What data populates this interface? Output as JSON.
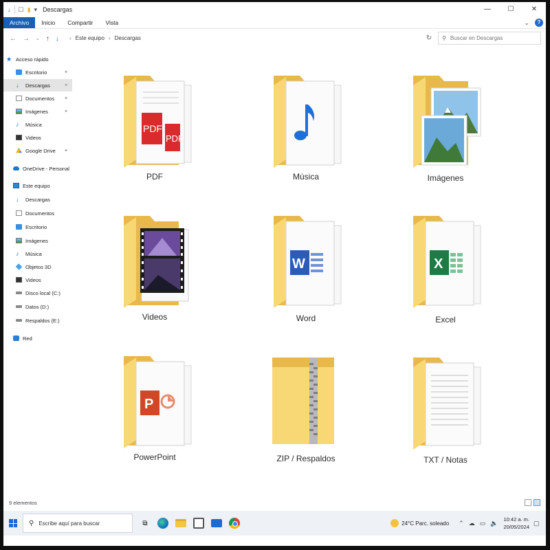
{
  "window": {
    "title": "Descargas"
  },
  "ribbon": {
    "tabs": [
      "Archivo",
      "Inicio",
      "Compartir",
      "Vista"
    ],
    "help": "?"
  },
  "address": {
    "path": [
      "Este equipo",
      "Descargas"
    ],
    "search_placeholder": "Buscar en Descargas"
  },
  "sidebar": {
    "items": [
      {
        "label": "Acceso rápido",
        "icon": "star-icon"
      },
      {
        "label": "Escritorio",
        "icon": "desktop-icon"
      },
      {
        "label": "Descargas",
        "icon": "download-icon"
      },
      {
        "label": "Documentos",
        "icon": "documents-icon"
      },
      {
        "label": "Imágenes",
        "icon": "pictures-icon"
      },
      {
        "label": "Música",
        "icon": "music-icon"
      },
      {
        "label": "Videos",
        "icon": "videos-icon"
      },
      {
        "label": "Google Drive",
        "icon": "google-drive-icon"
      },
      {
        "label": "OneDrive - Personal",
        "icon": "onedrive-icon"
      },
      {
        "label": "Este equipo",
        "icon": "this-pc-icon"
      },
      {
        "label": "Descargas",
        "icon": "download-icon"
      },
      {
        "label": "Documentos",
        "icon": "documents-icon"
      },
      {
        "label": "Escritorio",
        "icon": "desktop-icon"
      },
      {
        "label": "Imágenes",
        "icon": "pictures-icon"
      },
      {
        "label": "Música",
        "icon": "music-icon"
      },
      {
        "label": "Objetos 3D",
        "icon": "3d-objects-icon"
      },
      {
        "label": "Videos",
        "icon": "videos-icon"
      },
      {
        "label": "Disco local (C:)",
        "icon": "drive-icon"
      },
      {
        "label": "Datos (D:)",
        "icon": "drive-icon"
      },
      {
        "label": "Respaldos (E:)",
        "icon": "drive-icon"
      },
      {
        "label": "Red",
        "icon": "network-icon"
      }
    ]
  },
  "folders": [
    {
      "name": "PDF",
      "overlay": "pdf-icon"
    },
    {
      "name": "Música",
      "overlay": "music-note-icon"
    },
    {
      "name": "Imágenes",
      "overlay": "landscape-photo-icon"
    },
    {
      "name": "Videos",
      "overlay": "film-strip-icon"
    },
    {
      "name": "Word",
      "overlay": "word-icon"
    },
    {
      "name": "Excel",
      "overlay": "excel-icon"
    },
    {
      "name": "PowerPoint",
      "overlay": "powerpoint-icon"
    },
    {
      "name": "ZIP / Respaldos",
      "overlay": "zipper-icon"
    },
    {
      "name": "TXT / Notas",
      "overlay": "text-document-icon"
    }
  ],
  "status": {
    "count": "9 elementos"
  },
  "taskbar": {
    "search_placeholder": "Escribe aquí para buscar",
    "weather": "24°C  Parc. soleado",
    "time": "10:42 a. m.",
    "date": "20/05/2024"
  },
  "colors": {
    "folder_back": "#e8b94a",
    "folder_front": "#f8d775",
    "accent": "#1a5fb4",
    "pdf": "#d92b2b",
    "word": "#2b5cb8",
    "excel": "#1e7b45",
    "powerpoint": "#d24726"
  }
}
